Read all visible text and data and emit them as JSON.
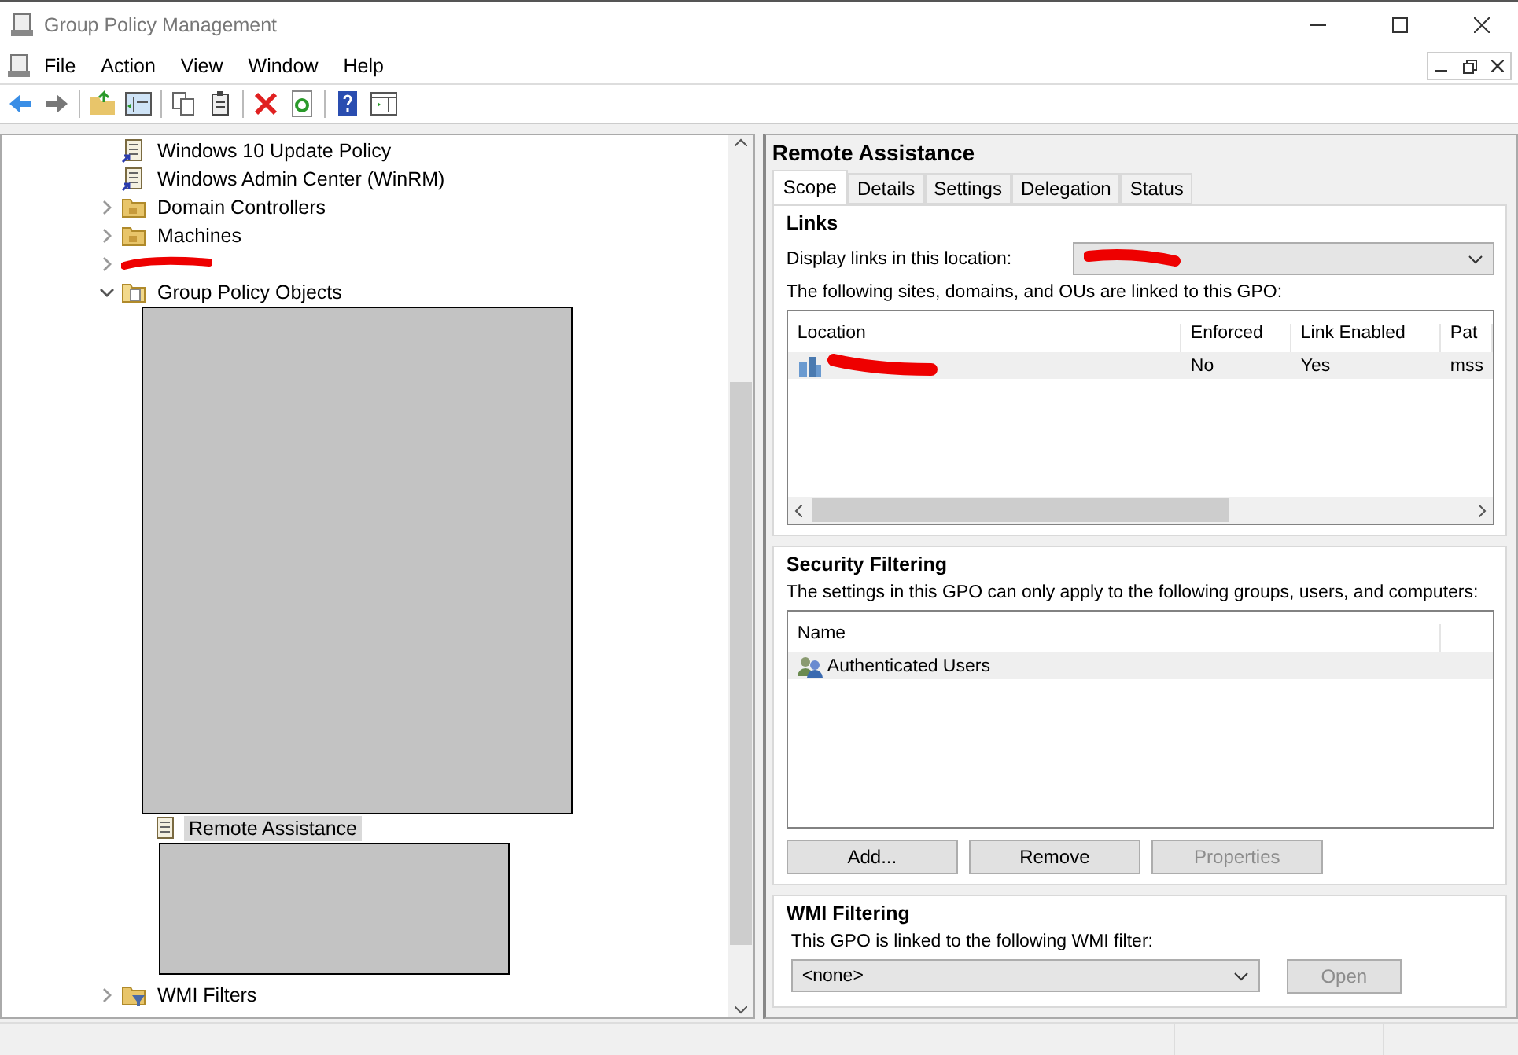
{
  "window": {
    "title": "Group Policy Management"
  },
  "menu": [
    {
      "label": "File"
    },
    {
      "label": "Action"
    },
    {
      "label": "View"
    },
    {
      "label": "Window"
    },
    {
      "label": "Help"
    }
  ],
  "tree": [
    {
      "label": "Windows 10 Update Policy",
      "kind": "link"
    },
    {
      "label": "Windows Admin Center (WinRM)",
      "kind": "link"
    },
    {
      "label": "Domain Controllers",
      "kind": "ou",
      "expanded": false
    },
    {
      "label": "Machines",
      "kind": "ou",
      "expanded": false
    },
    {
      "kind": "redacted",
      "expanded": false
    },
    {
      "label": "Group Policy Objects",
      "kind": "folder",
      "expanded": true,
      "children": [
        {
          "label": "Remote Assistance",
          "kind": "gpo",
          "selected": true
        }
      ]
    },
    {
      "label": "WMI Filters",
      "kind": "wmi",
      "expanded": false
    }
  ],
  "details": {
    "title": "Remote Assistance",
    "tabs": [
      {
        "label": "Scope",
        "selected": true
      },
      {
        "label": "Details",
        "selected": false
      },
      {
        "label": "Settings",
        "selected": false
      },
      {
        "label": "Delegation",
        "selected": false
      },
      {
        "label": "Status",
        "selected": false
      }
    ],
    "links": {
      "heading": "Links",
      "location_label": "Display links in this location:",
      "description": "The following sites, domains, and OUs are linked to this GPO:",
      "columns": [
        "Location",
        "Enforced",
        "Link Enabled",
        "Pat"
      ],
      "rows": [
        {
          "enforced": "No",
          "link_enabled": "Yes",
          "path": "mss"
        }
      ]
    },
    "security": {
      "heading": "Security Filtering",
      "description": "The settings in this GPO can only apply to the following groups, users, and computers:",
      "columns": [
        "Name"
      ],
      "rows": [
        "Authenticated Users"
      ],
      "buttons": [
        {
          "label": "Add...",
          "disabled": false
        },
        {
          "label": "Remove",
          "disabled": false
        },
        {
          "label": "Properties",
          "disabled": true
        }
      ]
    },
    "wmi": {
      "heading": "WMI Filtering",
      "description": "This GPO is linked to the following WMI filter:",
      "value": "<none>",
      "button": {
        "label": "Open",
        "disabled": true
      }
    }
  }
}
